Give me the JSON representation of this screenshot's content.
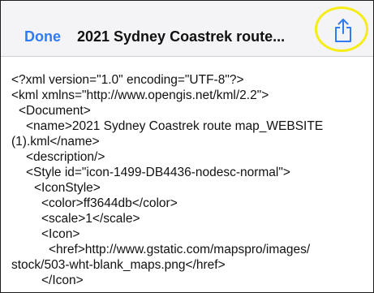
{
  "navbar": {
    "done_label": "Done",
    "title": "2021 Sydney Coastrek route...",
    "share_icon": "share-icon"
  },
  "accent_color": "#2f7bf6",
  "highlight_color": "#f5ec1a",
  "document_lines": [
    "<?xml version=\"1.0\" encoding=\"UTF-8\"?>",
    "<kml xmlns=\"http://www.opengis.net/kml/2.2\">",
    "<Document>",
    "<name>2021 Sydney Coastrek route map_WEBSITE",
    "(1).kml</name>",
    "<description/>",
    "<Style id=\"icon-1499-DB4436-nodesc-normal\">",
    "<IconStyle>",
    "<color>ff3644db</color>",
    "<scale>1</scale>",
    "<Icon>",
    "<href>http://www.gstatic.com/mapspro/images/",
    "stock/503-wht-blank_maps.png</href>",
    "</Icon>"
  ]
}
